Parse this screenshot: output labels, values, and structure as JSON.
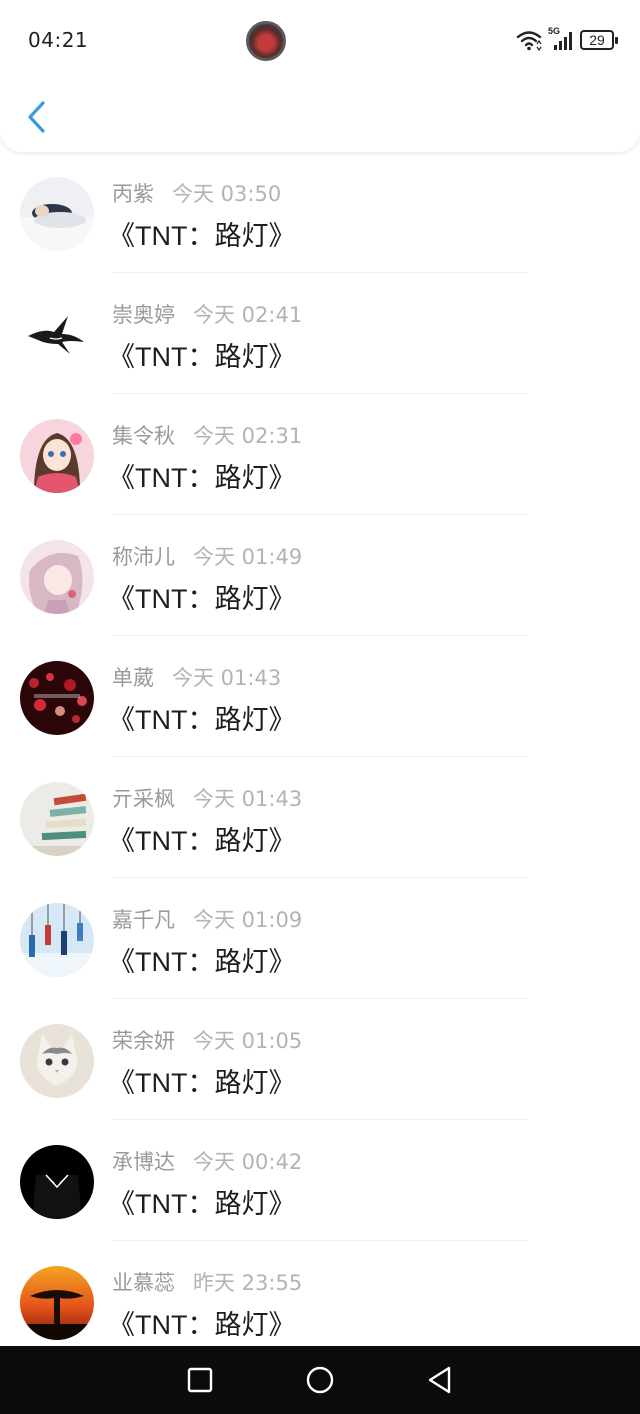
{
  "status_bar": {
    "time": "04:21",
    "network": "5G",
    "battery": "29"
  },
  "colors": {
    "accent": "#3a9ae0",
    "name_text": "#9a9a9a",
    "message_text": "#1e1e1e",
    "nav_bar": "#0b0b0b"
  },
  "comments": [
    {
      "name": "丙紫",
      "time": "今天 03:50",
      "message": "《TNT：路灯》",
      "avatar": "sleeping-person-avatar"
    },
    {
      "name": "崇奥婷",
      "time": "今天 02:41",
      "message": "《TNT：路灯》",
      "avatar": "swallow-bird-avatar"
    },
    {
      "name": "集令秋",
      "time": "今天 02:31",
      "message": "《TNT：路灯》",
      "avatar": "anime-girl-avatar"
    },
    {
      "name": "称沛儿",
      "time": "今天 01:49",
      "message": "《TNT：路灯》",
      "avatar": "anime-pink-avatar"
    },
    {
      "name": "单葳",
      "time": "今天 01:43",
      "message": "《TNT：路灯》",
      "avatar": "red-hearts-bokeh-avatar"
    },
    {
      "name": "亓采枫",
      "time": "今天 01:43",
      "message": "《TNT：路灯》",
      "avatar": "books-avatar"
    },
    {
      "name": "嘉千凡",
      "time": "今天 01:09",
      "message": "《TNT：路灯》",
      "avatar": "wind-chimes-avatar"
    },
    {
      "name": "荣余妍",
      "time": "今天 01:05",
      "message": "《TNT：路灯》",
      "avatar": "cat-avatar"
    },
    {
      "name": "承博达",
      "time": "今天 00:42",
      "message": "《TNT：路灯》",
      "avatar": "suit-tie-avatar"
    },
    {
      "name": "业慕蕊",
      "time": "昨天 23:55",
      "message": "《TNT：路灯》",
      "avatar": "sunset-tree-avatar"
    }
  ],
  "nav": {
    "recents": "square-icon",
    "home": "circle-icon",
    "back": "triangle-back-icon"
  }
}
